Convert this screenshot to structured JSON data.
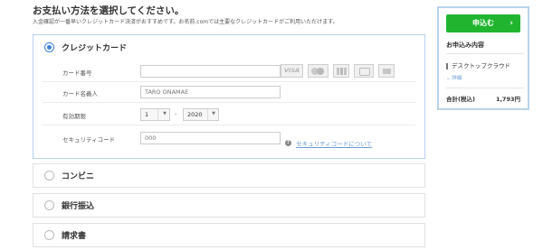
{
  "header": {
    "title": "お支払い方法を選択してください。",
    "subtitle": "入金確認が一番早いクレジットカード決済がおすすめです。お名前.comでは主要なクレジットカードがご利用いただけます。"
  },
  "payment_methods": {
    "credit_card": {
      "label": "クレジットカード",
      "selected": true,
      "card_number_label": "カード番号",
      "card_number_value": "",
      "brands": [
        "VISA",
        "MasterCard",
        "JCB",
        "American Express",
        "Diners Club"
      ],
      "card_name_label": "カード名義人",
      "card_name_placeholder": "TARO ONAMAE",
      "expiry_label": "有効期限",
      "expiry_month": "1",
      "expiry_separator": "-",
      "expiry_year": "2020",
      "security_label": "セキュリティコード",
      "security_placeholder": "000",
      "security_help": "セキュリティコードについて"
    },
    "convenience": {
      "label": "コンビニ",
      "selected": false
    },
    "bank_transfer": {
      "label": "銀行振込",
      "selected": false
    },
    "invoice": {
      "label": "請求書",
      "selected": false
    }
  },
  "sidebar": {
    "apply_label": "申込む",
    "apply_chevron": "›",
    "summary_title": "お申込み内容",
    "item_label": "デスクトップクラウド",
    "detail_link": "詳細",
    "total_label": "合計(税込)",
    "total_value": "1,793円"
  },
  "colors": {
    "accent_blue": "#3b82d6",
    "apply_green": "#21b52f",
    "panel_border": "#b5d2ef",
    "link_blue": "#6a9bd3"
  }
}
